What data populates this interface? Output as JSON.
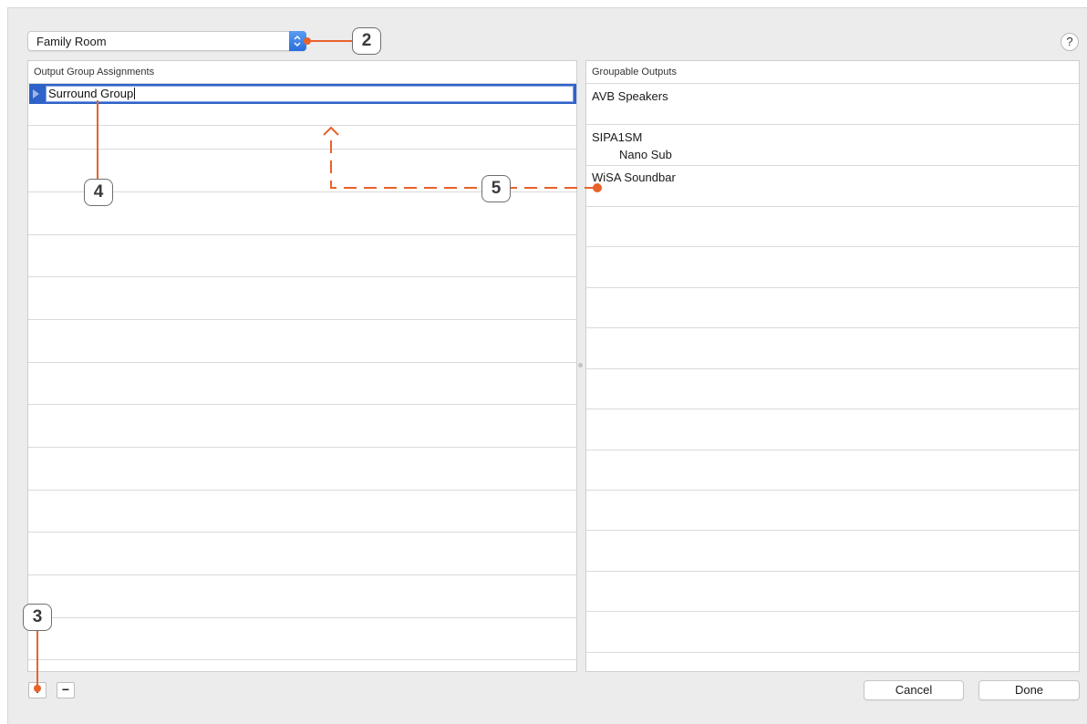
{
  "room_popup": {
    "value": "Family Room"
  },
  "help": {
    "label": "?"
  },
  "left_panel": {
    "header": "Output Group Assignments",
    "selected_row": {
      "value": "Surround Group"
    }
  },
  "right_panel": {
    "header": "Groupable Outputs",
    "items": [
      {
        "label": "AVB Speakers"
      },
      {
        "label": "SIPA1SM"
      },
      {
        "label": "Nano Sub"
      },
      {
        "label": "WiSA Soundbar"
      }
    ]
  },
  "bottom": {
    "add_label": "+",
    "remove_label": "−",
    "cancel_label": "Cancel",
    "done_label": "Done"
  },
  "callouts": {
    "c2": "2",
    "c3": "3",
    "c4": "4",
    "c5": "5"
  },
  "colors": {
    "accent": "#e8622a",
    "selection": "#2f62c8"
  }
}
